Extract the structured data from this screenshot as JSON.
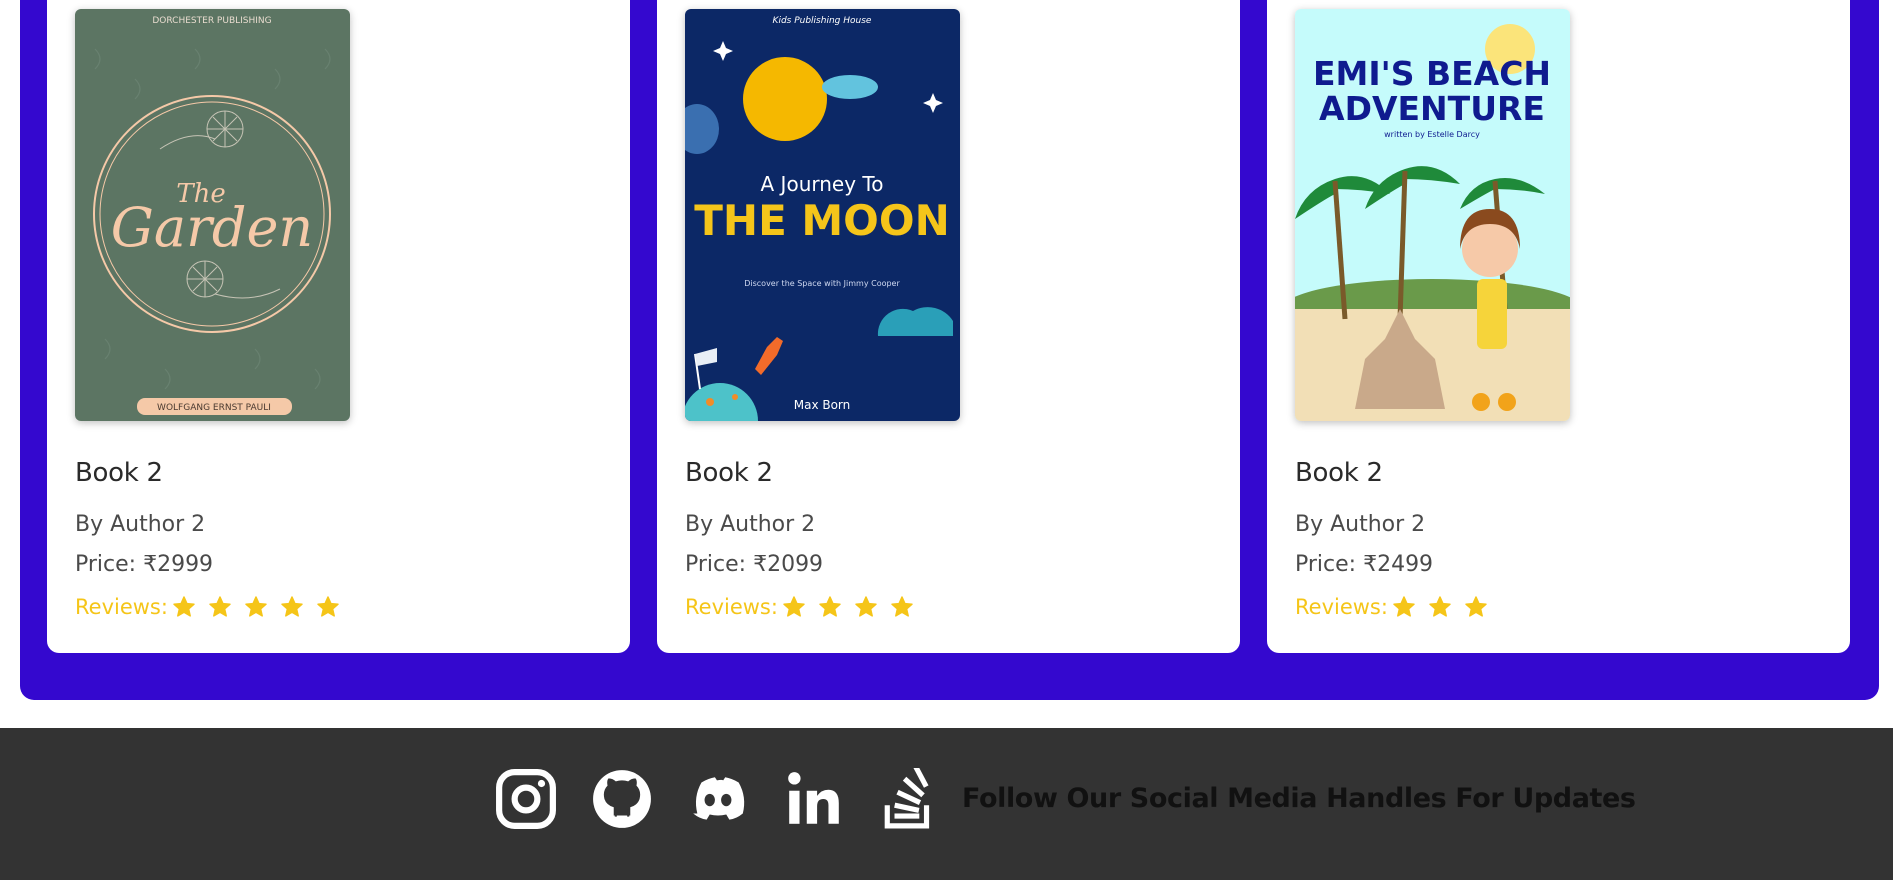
{
  "colors": {
    "accent": "#3408cf",
    "footer_bg": "#333333",
    "star": "#f5c518",
    "card_bg": "#ffffff"
  },
  "books": [
    {
      "title": "Book 2",
      "author": "By Author 2",
      "price": "Price: ₹2999",
      "reviews_label": "Reviews:",
      "stars": 5,
      "cover": {
        "publisher": "DORCHESTER PUBLISHING",
        "title_small": "The",
        "title_large": "Garden",
        "author": "WOLFGANG ERNST PAULI"
      }
    },
    {
      "title": "Book 2",
      "author": "By Author 2",
      "price": "Price: ₹2099",
      "reviews_label": "Reviews:",
      "stars": 4,
      "cover": {
        "publisher": "Kids Publishing House",
        "title_small": "A Journey To",
        "title_large": "THE MOON",
        "tagline": "Discover the Space with Jimmy Cooper",
        "author": "Max Born"
      }
    },
    {
      "title": "Book 2",
      "author": "By Author 2",
      "price": "Price: ₹2499",
      "reviews_label": "Reviews:",
      "stars": 3,
      "cover": {
        "title_line1": "EMI'S BEACH",
        "title_line2": "ADVENTURE",
        "byline": "written by Estelle Darcy"
      }
    }
  ],
  "footer": {
    "icons": [
      "instagram-icon",
      "github-icon",
      "discord-icon",
      "linkedin-icon",
      "stackoverflow-icon"
    ],
    "text": "Follow Our Social Media Handles For Updates"
  }
}
